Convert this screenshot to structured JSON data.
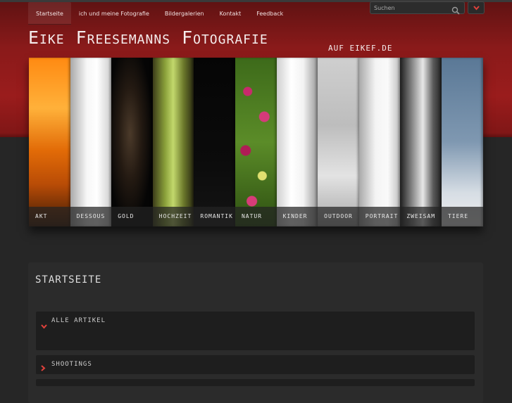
{
  "nav": {
    "items": [
      {
        "label": "Startseite",
        "active": true
      },
      {
        "label": "ich und meine Fotografie",
        "active": false
      },
      {
        "label": "Bildergalerien",
        "active": false
      },
      {
        "label": "Kontakt",
        "active": false
      },
      {
        "label": "Feedback",
        "active": false
      }
    ]
  },
  "search": {
    "placeholder": "Suchen",
    "icon": "search-icon"
  },
  "header": {
    "title": "Eike Freesemanns Fotografie",
    "subtitle": "auf eikef.de"
  },
  "gallery": {
    "items": [
      {
        "label": "Akt"
      },
      {
        "label": "Dessous"
      },
      {
        "label": "Gold"
      },
      {
        "label": "Hochzeit"
      },
      {
        "label": "Romantik"
      },
      {
        "label": "Natur"
      },
      {
        "label": "Kinder"
      },
      {
        "label": "Outdoor"
      },
      {
        "label": "Portrait"
      },
      {
        "label": "Zweisam"
      },
      {
        "label": "Tiere"
      }
    ]
  },
  "main": {
    "title": "Startseite",
    "sections": [
      {
        "label": "Alle Artikel",
        "expanded": true
      },
      {
        "label": "Shootings",
        "expanded": false
      }
    ]
  },
  "colors": {
    "header_red": "#9a1c1c",
    "background": "#262626",
    "accent_arrow": "#e0413b"
  }
}
